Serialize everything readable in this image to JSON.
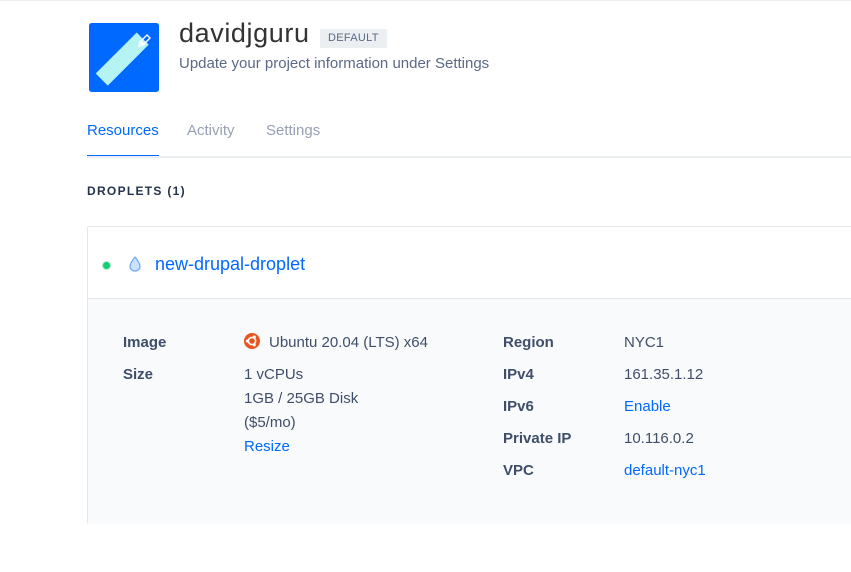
{
  "project": {
    "name": "davidjguru",
    "badge": "DEFAULT",
    "subtitle": "Update your project information under Settings"
  },
  "tabs": [
    {
      "label": "Resources",
      "active": true
    },
    {
      "label": "Activity",
      "active": false
    },
    {
      "label": "Settings",
      "active": false
    }
  ],
  "droplets_section": {
    "title": "DROPLETS (1)"
  },
  "droplet": {
    "name": "new-drupal-droplet",
    "status_color": "#15cd72",
    "icon": "droplet-icon",
    "image_label": "Image",
    "image_value": "Ubuntu 20.04 (LTS) x64",
    "image_icon": "ubuntu-icon",
    "size_label": "Size",
    "size_cpu": "1 vCPUs",
    "size_mem": "1GB / 25GB Disk",
    "size_price": "($5/mo)",
    "resize_link": "Resize",
    "region_label": "Region",
    "region_value": "NYC1",
    "ipv4_label": "IPv4",
    "ipv4_value": "161.35.1.12",
    "ipv6_label": "IPv6",
    "ipv6_link": "Enable",
    "private_ip_label": "Private IP",
    "private_ip_value": "10.116.0.2",
    "vpc_label": "VPC",
    "vpc_link": "default-nyc1"
  },
  "colors": {
    "accent": "#0069ff",
    "project_icon_bg": "#0069ff",
    "ubuntu": "#e95420"
  }
}
